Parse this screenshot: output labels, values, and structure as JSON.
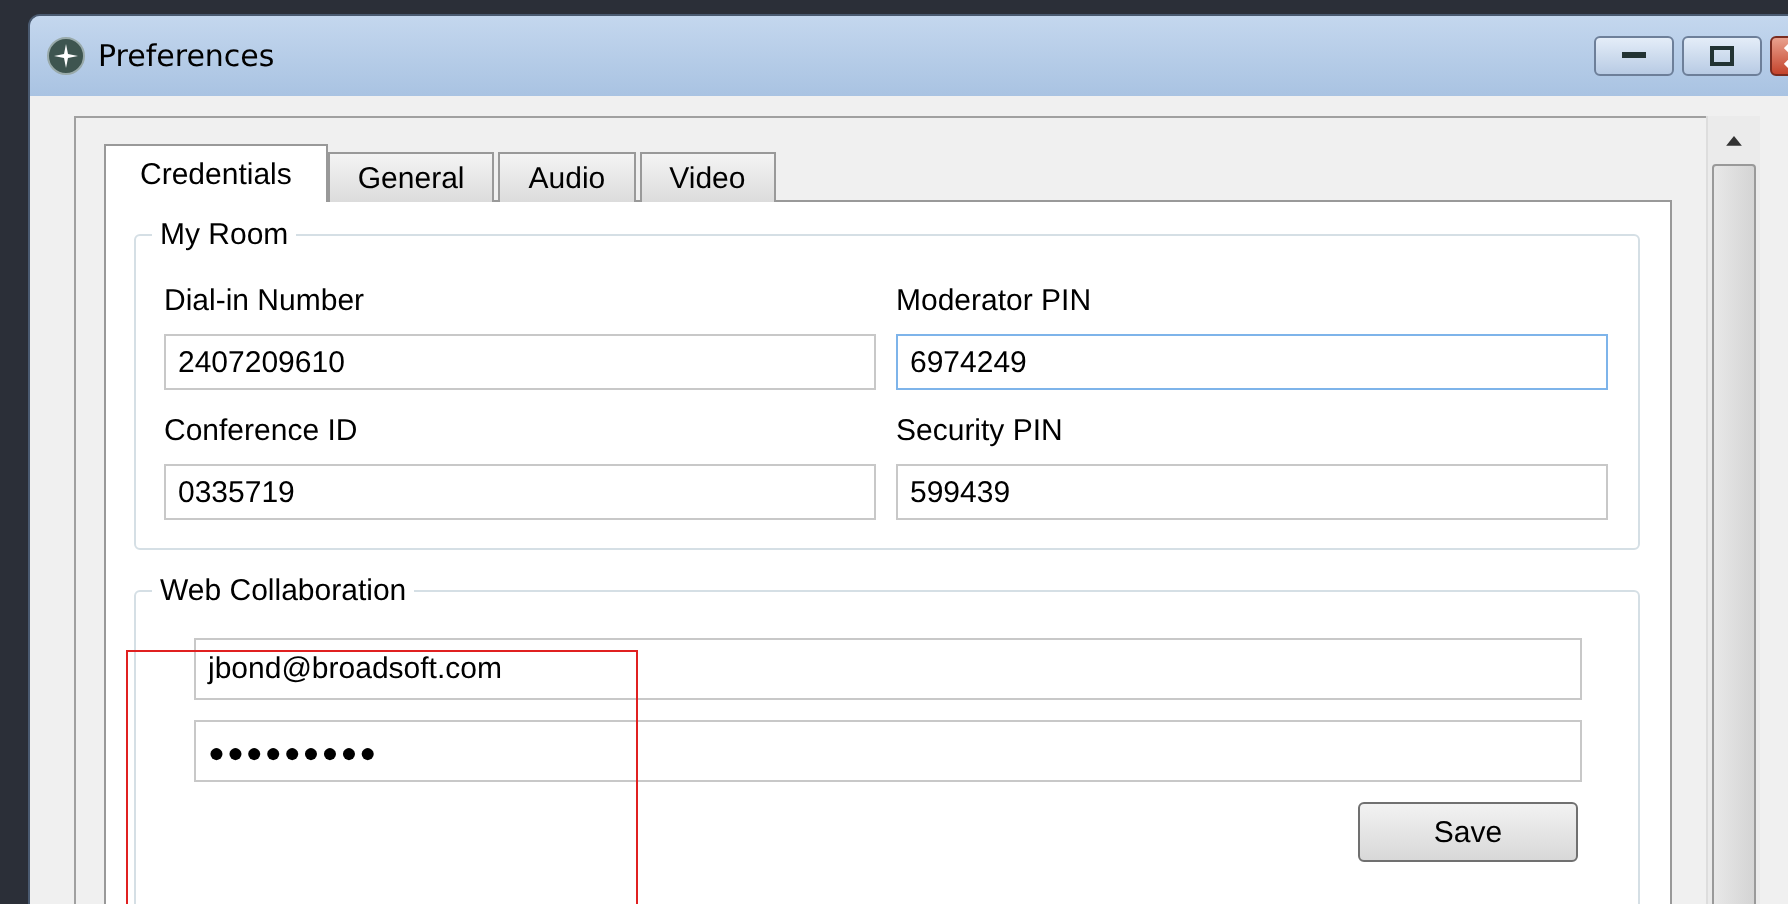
{
  "window": {
    "title": "Preferences"
  },
  "tabs": [
    {
      "label": "Credentials",
      "selected": true
    },
    {
      "label": "General",
      "selected": false
    },
    {
      "label": "Audio",
      "selected": false
    },
    {
      "label": "Video",
      "selected": false
    }
  ],
  "my_room": {
    "title": "My Room",
    "fields": [
      {
        "label": "Dial-in Number",
        "value": "2407209610",
        "focused": false
      },
      {
        "label": "Moderator PIN",
        "value": "6974249",
        "focused": true
      },
      {
        "label": "Conference ID",
        "value": "0335719",
        "focused": false
      },
      {
        "label": "Security PIN",
        "value": "599439",
        "focused": false
      }
    ]
  },
  "web_collaboration": {
    "title": "Web Collaboration",
    "highlighted": true,
    "fields": [
      {
        "kind": "text",
        "value": "jbond@broadsoft.com"
      },
      {
        "kind": "password",
        "value": "●●●●●●●●●"
      }
    ],
    "button": "Save"
  }
}
